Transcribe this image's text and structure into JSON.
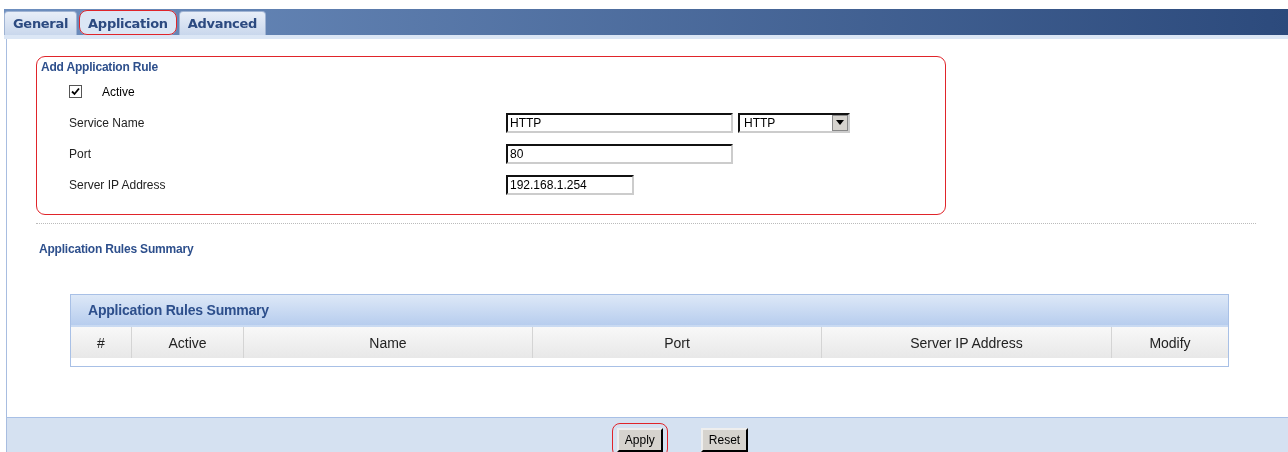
{
  "tabs": [
    {
      "label": "General",
      "selected": false,
      "highlighted": false
    },
    {
      "label": "Application",
      "selected": true,
      "highlighted": true
    },
    {
      "label": "Advanced",
      "selected": false,
      "highlighted": false
    }
  ],
  "add_rule": {
    "title": "Add Application Rule",
    "highlighted": true,
    "active": {
      "label": "Active",
      "checked": true
    },
    "fields": [
      {
        "kind": "text-select",
        "label": "Service Name",
        "value": "HTTP",
        "select": "HTTP"
      },
      {
        "kind": "text",
        "label": "Port",
        "value": "80"
      },
      {
        "kind": "short-text",
        "label": "Server IP Address",
        "value": "192.168.1.254"
      }
    ]
  },
  "summary": {
    "title": "Application Rules Summary",
    "table_title": "Application Rules Summary",
    "columns": [
      "#",
      "Active",
      "Name",
      "Port",
      "Server IP Address",
      "Modify"
    ]
  },
  "buttons": [
    {
      "label": "Apply",
      "highlighted": true
    },
    {
      "label": "Reset",
      "highlighted": false
    }
  ]
}
